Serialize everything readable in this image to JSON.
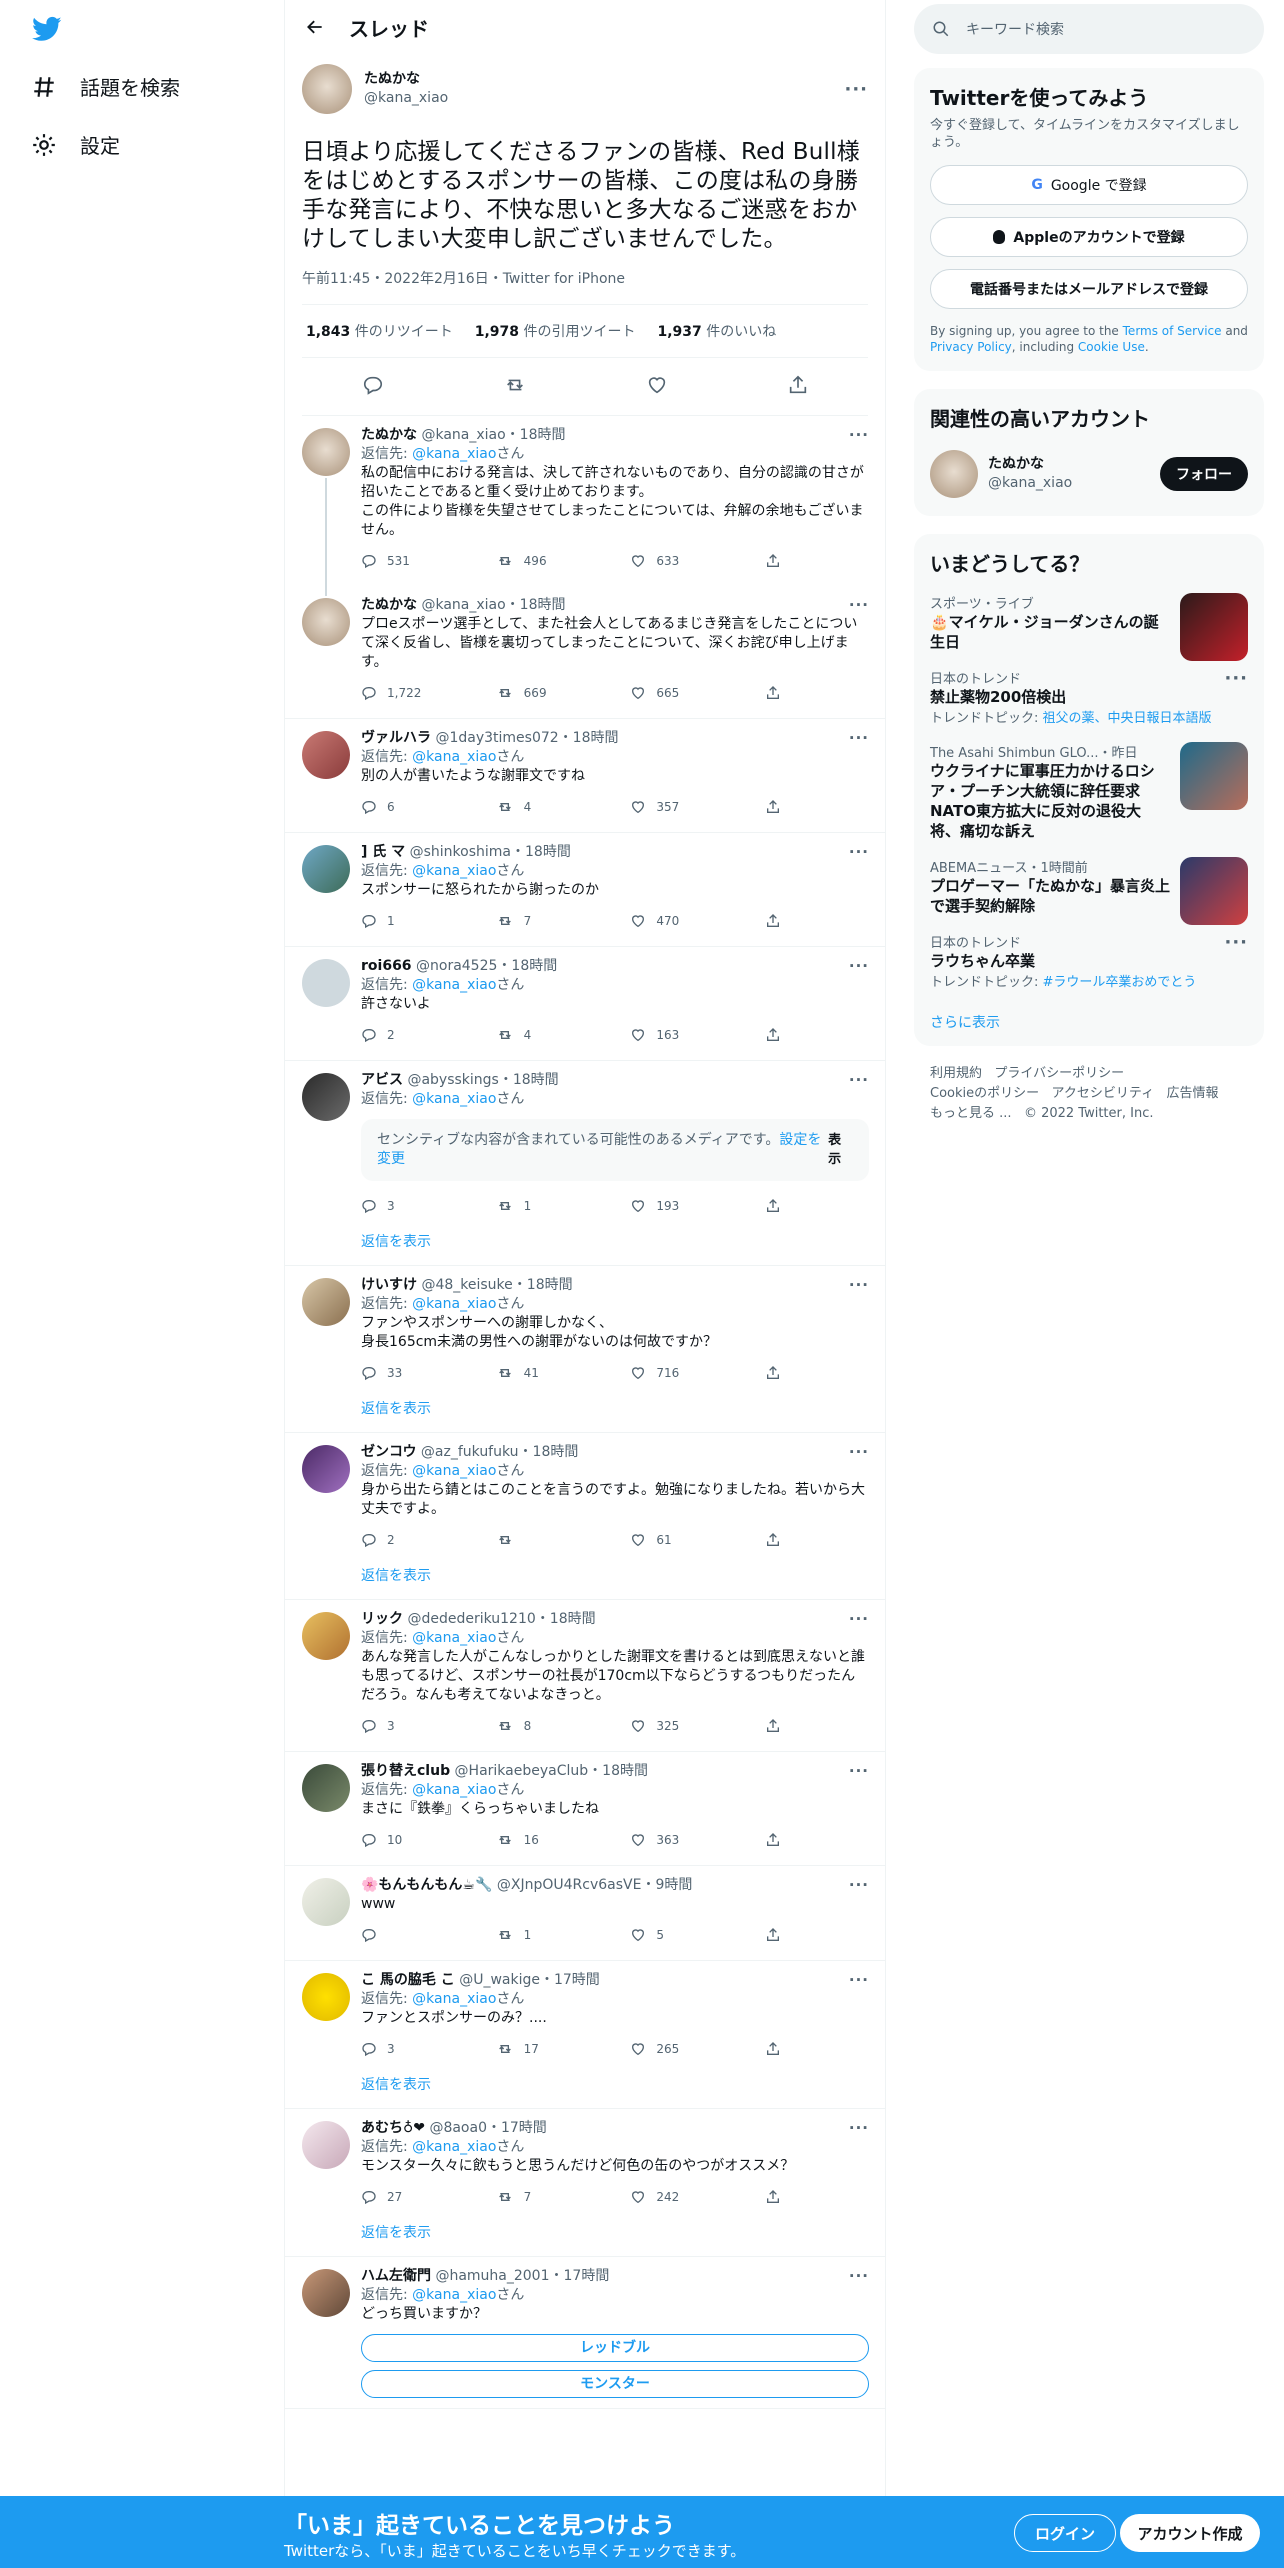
{
  "nav": {
    "explore": "話題を検索",
    "settings": "設定"
  },
  "header": {
    "title": "スレッド"
  },
  "main": {
    "name": "たぬかな",
    "handle": "@kana_xiao",
    "text": "日頃より応援してくださるファンの皆様、Red Bull様をはじめとするスポンサーの皆様、この度は私の身勝手な発言により、不快な思いと多大なるご迷惑をおかけしてしまい大変申し訳ございませんでした。",
    "meta": "午前11:45・2022年2月16日・Twitter for iPhone",
    "retweets": "1,843",
    "retweets_label": "件のリツイート",
    "quotes": "1,978",
    "quotes_label": "件の引用ツイート",
    "likes": "1,937",
    "likes_label": "件のいいね"
  },
  "replies": [
    {
      "name": "たぬかな",
      "handle": "@kana_xiao",
      "time": "18時間",
      "to": "@kana_xiao",
      "to_suffix": "さん",
      "text": "私の配信中における発言は、決して許されないものであり、自分の認識の甘さが招いたことであると重く受け止めております。\nこの件により皆様を失望させてしまったことについては、弁解の余地もございません。",
      "reply": "531",
      "retweet": "496",
      "like": "633"
    },
    {
      "name": "たぬかな",
      "handle": "@kana_xiao",
      "time": "18時間",
      "to": "",
      "to_suffix": "",
      "text": "プロeスポーツ選手として、また社会人としてあるまじき発言をしたことについて深く反省し、皆様を裏切ってしまったことについて、深くお詫び申し上げます。",
      "reply": "1,722",
      "retweet": "669",
      "like": "665"
    },
    {
      "name": "ヴァルハラ",
      "handle": "@1day3times072",
      "time": "18時間",
      "to": "@kana_xiao",
      "to_suffix": "さん",
      "text": "別の人が書いたような謝罪文ですね",
      "reply": "6",
      "retweet": "4",
      "like": "357"
    },
    {
      "name": "] 氏 マ",
      "handle": "@shinkoshima",
      "time": "18時間",
      "to": "@kana_xiao",
      "to_suffix": "さん",
      "text": "スポンサーに怒られたから謝ったのか",
      "reply": "1",
      "retweet": "7",
      "like": "470"
    },
    {
      "name": "roi666",
      "handle": "@nora4525",
      "time": "18時間",
      "to": "@kana_xiao",
      "to_suffix": "さん",
      "text": "許さないよ",
      "reply": "2",
      "retweet": "4",
      "like": "163"
    },
    {
      "name": "アビス",
      "handle": "@abysskings",
      "time": "18時間",
      "to": "@kana_xiao",
      "to_suffix": "さん",
      "text": "",
      "reply": "3",
      "retweet": "1",
      "like": "193"
    },
    {
      "name": "けいすけ",
      "handle": "@48_keisuke",
      "time": "18時間",
      "to": "@kana_xiao",
      "to_suffix": "さん",
      "text": "ファンやスポンサーへの謝罪しかなく、\n身長165cm未満の男性への謝罪がないのは何故ですか？",
      "reply": "33",
      "retweet": "41",
      "like": "716"
    },
    {
      "name": "ゼンコウ",
      "handle": "@az_fukufuku",
      "time": "18時間",
      "to": "@kana_xiao",
      "to_suffix": "さん",
      "text": "身から出たら錆とはこのことを言うのですよ。勉強になりましたね。若いから大丈夫ですよ。",
      "reply": "2",
      "retweet": "",
      "like": "61"
    },
    {
      "name": "リック",
      "handle": "@dedederiku1210",
      "time": "18時間",
      "to": "@kana_xiao",
      "to_suffix": "さん",
      "text": "あんな発言した人がこんなしっかりとした謝罪文を書けるとは到底思えないと誰も思ってるけど、スポンサーの社長が170cm以下ならどうするつもりだったんだろう。なんも考えてないよなきっと。",
      "reply": "3",
      "retweet": "8",
      "like": "325"
    },
    {
      "name": "張り替えclub",
      "handle": "@HarikaebeyaClub",
      "time": "18時間",
      "to": "@kana_xiao",
      "to_suffix": "さん",
      "text": "まさに『鉄拳』くらっちゃいましたね",
      "reply": "10",
      "retweet": "16",
      "like": "363"
    },
    {
      "name": "🌸もんもんもん☕🔧",
      "handle": "@XJnpOU4Rcv6asVE",
      "time": "9時間",
      "to": "",
      "to_suffix": "",
      "text": "www",
      "reply": "",
      "retweet": "1",
      "like": "5"
    },
    {
      "name": "こ 馬の脇毛 こ",
      "handle": "@U_wakige",
      "time": "17時間",
      "to": "@kana_xiao",
      "to_suffix": "さん",
      "text": "ファンとスポンサーのみ？....",
      "reply": "3",
      "retweet": "17",
      "like": "265"
    },
    {
      "name": "あむち♁❤",
      "handle": "@8aoa0",
      "time": "17時間",
      "to": "@kana_xiao",
      "to_suffix": "さん",
      "text": "モンスター久々に飲もうと思うんだけど何色の缶のやつがオススメ？",
      "reply": "27",
      "retweet": "7",
      "like": "242"
    },
    {
      "name": "ハム左衛門",
      "handle": "@hamuha_2001",
      "time": "17時間",
      "to": "@kana_xiao",
      "to_suffix": "さん",
      "text": "どっち買いますか？",
      "reply": "",
      "retweet": "",
      "like": ""
    }
  ],
  "reply_to_label": "返信先: ",
  "show_replies": "返信を表示",
  "sensitive": {
    "text": "センシティブな内容が含まれている可能性のあるメディアです。",
    "link": "設定を変更",
    "button": "表示"
  },
  "poll": {
    "option1": "レッドブル",
    "option2": "モンスター"
  },
  "sidebar": {
    "search_placeholder": "キーワード検索",
    "signup": {
      "title": "Twitterを使ってみよう",
      "subtitle": "今すぐ登録して、タイムラインをカスタマイズしましょう。",
      "google": "Google で登録",
      "apple": "Appleのアカウントで登録",
      "phone": "電話番号またはメールアドレスで登録",
      "legal_pre": "By signing up, you agree to the ",
      "tos": "Terms of Service",
      "legal_and": " and ",
      "privacy": "Privacy Policy",
      "legal_incl": ", including ",
      "cookie": "Cookie Use",
      "legal_end": "."
    },
    "related": {
      "title": "関連性の高いアカウント",
      "name": "たぬかな",
      "handle": "@kana_xiao",
      "follow": "フォロー"
    },
    "trends": {
      "title": "いまどうしてる？",
      "items": [
        {
          "kicker": "スポーツ・ライブ",
          "headline": "🎂マイケル・ジョーダンさんの誕生日",
          "topics_label": "",
          "topics": ""
        },
        {
          "kicker": "日本のトレンド",
          "headline": "禁止薬物200倍検出",
          "topics_label": "トレンドトピック: ",
          "topics": "祖父の薬、中央日報日本語版"
        },
        {
          "kicker": "The Asahi Shimbun GLO...・昨日",
          "headline": "ウクライナに軍事圧力かけるロシア・プーチン大統領に辞任要求 NATO東方拡大に反対の退役大将、痛切な訴え",
          "topics_label": "",
          "topics": ""
        },
        {
          "kicker": "ABEMAニュース・1時間前",
          "headline": "プロゲーマー「たぬかな」暴言炎上で選手契約解除",
          "topics_label": "",
          "topics": ""
        },
        {
          "kicker": "日本のトレンド",
          "headline": "ラウちゃん卒業",
          "topics_label": "トレンドトピック: ",
          "topics": "#ラウール卒業おめでとう"
        }
      ],
      "more": "さらに表示"
    },
    "footer": {
      "l1": "利用規約",
      "l2": "プライバシーポリシー",
      "l3": "Cookieのポリシー",
      "l4": "アクセシビリティ",
      "l5": "広告情報",
      "l6": "もっと見る ...",
      "l7": "© 2022 Twitter, Inc."
    }
  },
  "bottom": {
    "title": "「いま」起きていることを見つけよう",
    "subtitle": "Twitterなら、「いま」起きていることをいち早くチェックできます。",
    "login": "ログイン",
    "signup": "アカウント作成"
  },
  "colors": {
    "brand": "#1d9bf0",
    "like": "#f91880"
  }
}
